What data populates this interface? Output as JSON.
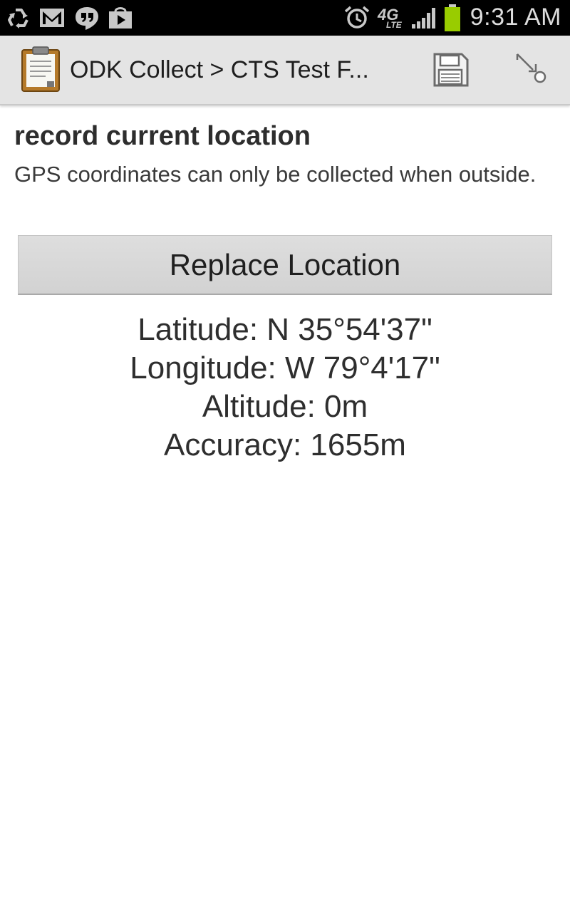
{
  "status_bar": {
    "time": "9:31 AM",
    "network_label": "4G",
    "network_sub": "LTE",
    "battery_color": "#99cc00",
    "icons": [
      "recycle-icon",
      "gmail-icon",
      "hangouts-icon",
      "play-store-icon",
      "alarm-icon",
      "lte-icon",
      "signal-icon",
      "battery-icon"
    ]
  },
  "action_bar": {
    "title": "ODK Collect > CTS Test F...",
    "app_icon": "clipboard-icon",
    "save_icon": "save-icon",
    "jump_icon": "jump-icon"
  },
  "question": {
    "label": "record current location",
    "hint": "GPS coordinates can only be collected when outside."
  },
  "replace_button": {
    "label": "Replace Location"
  },
  "location": {
    "latitude": "Latitude: N 35°54'37\"",
    "longitude": "Longitude: W 79°4'17\"",
    "altitude": "Altitude: 0m",
    "accuracy": "Accuracy: 1655m"
  }
}
